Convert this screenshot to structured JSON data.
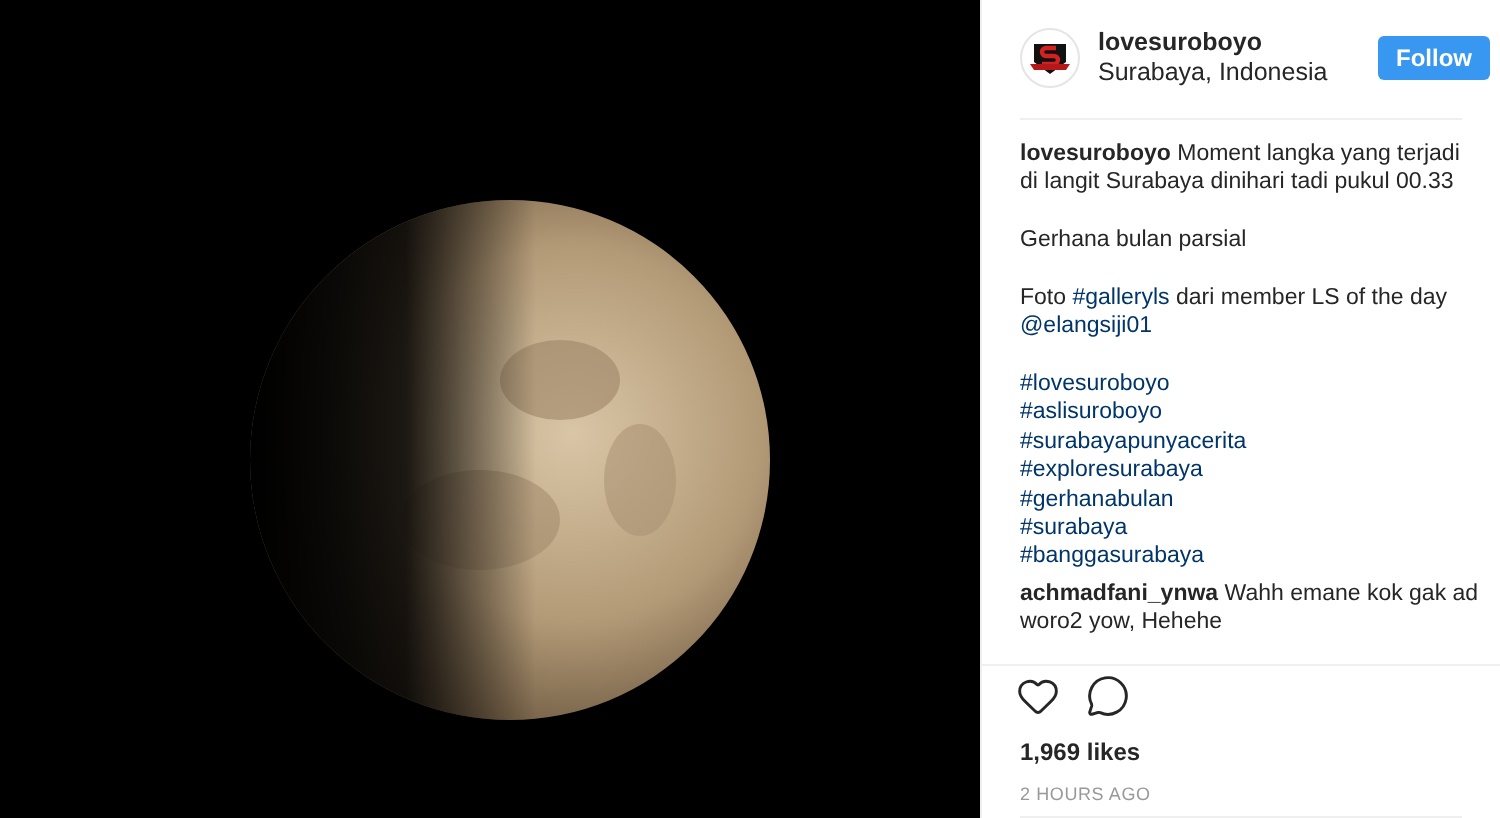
{
  "post": {
    "username": "lovesuroboyo",
    "location": "Surabaya, Indonesia",
    "follow_button": "Follow"
  },
  "caption": {
    "author": "lovesuroboyo",
    "paragraphs": [
      [
        {
          "kind": "text",
          "text": "Moment langka yang terjadi di langit Surabaya dinihari tadi pukul 00.33"
        }
      ],
      [
        {
          "kind": "text",
          "text": "Gerhana bulan parsial"
        }
      ],
      [
        {
          "kind": "text",
          "text": "Foto "
        },
        {
          "kind": "link",
          "text": "#galleryls"
        },
        {
          "kind": "text",
          "text": " dari member LS of the day "
        },
        {
          "kind": "link",
          "text": "@elangsiji01"
        }
      ],
      [
        {
          "kind": "link",
          "text": "#lovesuroboyo"
        },
        {
          "kind": "link",
          "text": "#aslisuroboyo"
        },
        {
          "kind": "link",
          "text": "#surabayapunyacerita"
        },
        {
          "kind": "link",
          "text": "#exploresurabaya"
        },
        {
          "kind": "link",
          "text": "#gerhanabulan"
        },
        {
          "kind": "link",
          "text": "#surabaya"
        },
        {
          "kind": "link",
          "text": "#banggasurabaya"
        }
      ]
    ]
  },
  "comments": [
    {
      "author": "achmadfani_ynwa",
      "text": "Wahh emane kok gak ad woro2 yow, Hehehe"
    }
  ],
  "likes": "1,969 likes",
  "time": "2 HOURS AGO"
}
